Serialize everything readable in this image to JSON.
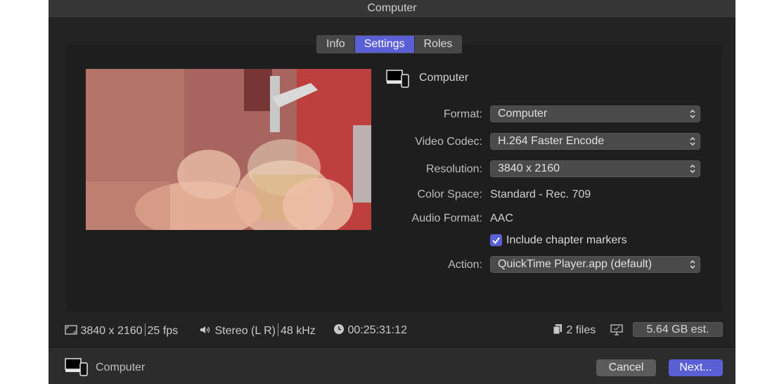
{
  "window": {
    "title": "Computer"
  },
  "tabs": [
    {
      "label": "Info",
      "active": false
    },
    {
      "label": "Settings",
      "active": true
    },
    {
      "label": "Roles",
      "active": false
    }
  ],
  "destination": {
    "name": "Computer",
    "icon": "computer-device-icon"
  },
  "settings": {
    "format": {
      "label": "Format:",
      "value": "Computer"
    },
    "video_codec": {
      "label": "Video Codec:",
      "value": "H.264 Faster Encode"
    },
    "resolution": {
      "label": "Resolution:",
      "value": "3840 x 2160"
    },
    "color_space": {
      "label": "Color Space:",
      "value": "Standard - Rec. 709"
    },
    "audio_format": {
      "label": "Audio Format:",
      "value": "AAC"
    },
    "chapter_markers": {
      "label": "Include chapter markers",
      "checked": true
    },
    "action": {
      "label": "Action:",
      "value": "QuickTime Player.app (default)"
    }
  },
  "status": {
    "resolution": "3840 x 2160",
    "fps": "25 fps",
    "audio": "Stereo (L R)",
    "sample_rate": "48 kHz",
    "duration": "00:25:31:12",
    "files": "2 files",
    "estimate": "5.64 GB est."
  },
  "footer": {
    "destination": "Computer",
    "cancel_label": "Cancel",
    "next_label": "Next..."
  },
  "colors": {
    "accent": "#5a5fd6",
    "background": "#232323",
    "panel": "#1e1e1e"
  }
}
